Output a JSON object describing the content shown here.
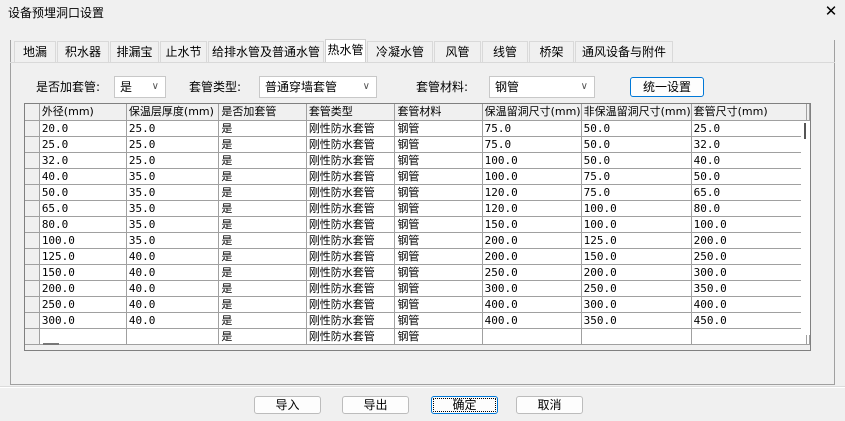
{
  "window": {
    "title": "设备预埋洞口设置",
    "close": "✕"
  },
  "tabs": [
    "地漏",
    "积水器",
    "排漏宝",
    "止水节",
    "给排水管及普通水管",
    "热水管",
    "冷凝水管",
    "风管",
    "线管",
    "桥架",
    "通风设备与附件"
  ],
  "selected_tab": "热水管",
  "controls": {
    "add_sleeve_label": "是否加套管:",
    "add_sleeve_value": "是",
    "sleeve_type_label": "套管类型:",
    "sleeve_type_value": "普通穿墙套管",
    "sleeve_material_label": "套管材料:",
    "sleeve_material_value": "钢管",
    "unify_button": "统一设置"
  },
  "grid": {
    "columns": [
      "外径(mm)",
      "保温层厚度(mm)",
      "是否加套管",
      "套管类型",
      "套管材料",
      "保温留洞尺寸(mm)",
      "非保温留洞尺寸(mm)",
      "套管尺寸(mm)"
    ],
    "rows": [
      [
        "20.0",
        "25.0",
        "是",
        "刚性防水套管",
        "钢管",
        "75.0",
        "50.0",
        "25.0"
      ],
      [
        "25.0",
        "25.0",
        "是",
        "刚性防水套管",
        "钢管",
        "75.0",
        "50.0",
        "32.0"
      ],
      [
        "32.0",
        "25.0",
        "是",
        "刚性防水套管",
        "钢管",
        "100.0",
        "50.0",
        "40.0"
      ],
      [
        "40.0",
        "35.0",
        "是",
        "刚性防水套管",
        "钢管",
        "100.0",
        "75.0",
        "50.0"
      ],
      [
        "50.0",
        "35.0",
        "是",
        "刚性防水套管",
        "钢管",
        "120.0",
        "75.0",
        "65.0"
      ],
      [
        "65.0",
        "35.0",
        "是",
        "刚性防水套管",
        "钢管",
        "120.0",
        "100.0",
        "80.0"
      ],
      [
        "80.0",
        "35.0",
        "是",
        "刚性防水套管",
        "钢管",
        "150.0",
        "100.0",
        "100.0"
      ],
      [
        "100.0",
        "35.0",
        "是",
        "刚性防水套管",
        "钢管",
        "200.0",
        "125.0",
        "200.0"
      ],
      [
        "125.0",
        "40.0",
        "是",
        "刚性防水套管",
        "钢管",
        "200.0",
        "150.0",
        "250.0"
      ],
      [
        "150.0",
        "40.0",
        "是",
        "刚性防水套管",
        "钢管",
        "250.0",
        "200.0",
        "300.0"
      ],
      [
        "200.0",
        "40.0",
        "是",
        "刚性防水套管",
        "钢管",
        "300.0",
        "250.0",
        "350.0"
      ],
      [
        "250.0",
        "40.0",
        "是",
        "刚性防水套管",
        "钢管",
        "400.0",
        "300.0",
        "400.0"
      ],
      [
        "300.0",
        "40.0",
        "是",
        "刚性防水套管",
        "钢管",
        "400.0",
        "350.0",
        "450.0"
      ],
      [
        "",
        "",
        "是",
        "刚性防水套管",
        "钢管",
        "",
        "",
        ""
      ]
    ]
  },
  "buttons": {
    "import": "导入",
    "export": "导出",
    "ok": "确定",
    "cancel": "取消"
  }
}
